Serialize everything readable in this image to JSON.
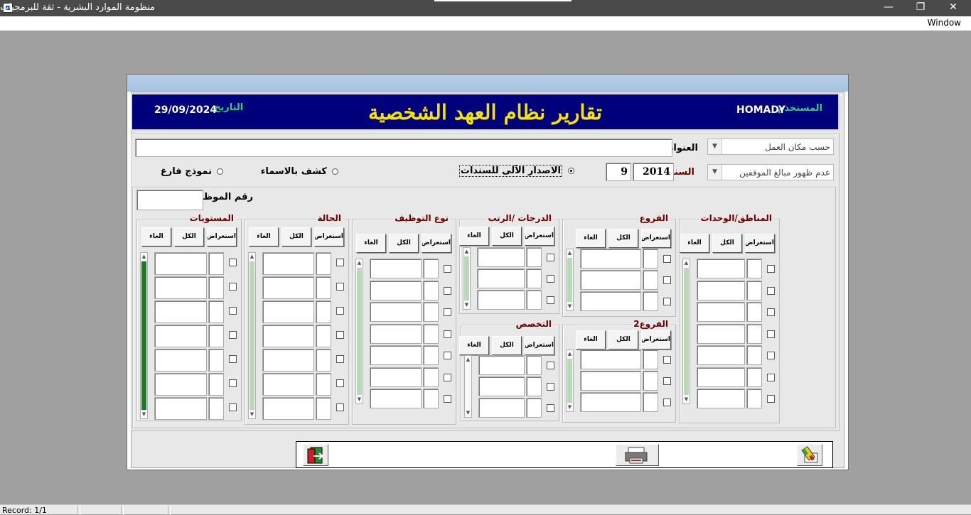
{
  "window": {
    "title": "منظومة الموارد البشرية - ثقة للبرمجيات",
    "minimize": "—",
    "restore": "❐",
    "close": "✕",
    "menu_window": "Window"
  },
  "header": {
    "title": "تقارير نظام العهد الشخصية",
    "user_label": "المستخدم",
    "user_value": "HOMADY",
    "date_label": "التاريخ",
    "date_value": "29/09/2024"
  },
  "filters": {
    "workplace_combo": "حسب مكان العمل",
    "address_label": "العنوان",
    "address_value": "",
    "dues_combo": "عدم ظهور مبالغ الموقفين",
    "year_label": "السنة",
    "year_value": "2014",
    "month_value": "9",
    "radio_auto_issue": "الاصدار الآلى للسندات",
    "radio_names": "كشف بالاسماء",
    "radio_empty": "نموذج فارغ",
    "employee_no_label": "رقم الموظف",
    "employee_no_value": ""
  },
  "panel_buttons": {
    "browse": "استعراض",
    "all": "الكل",
    "cancel": "الغاء"
  },
  "panels": {
    "regions": "المناطق/الوحدات",
    "branches": "الفروع",
    "grades": "الدرجات /الرتب",
    "employment_type": "نوع التوظيف",
    "status": "الحالة",
    "levels": "المستويات",
    "branches2": "الفروع2",
    "specialization": "التخصص"
  },
  "toolbar": {
    "exit_icon": "exit-door-icon",
    "print_icon": "printer-icon",
    "clear_icon": "eraser-icon"
  },
  "status": {
    "record": "Record: 1/1"
  },
  "colors": {
    "header_bg": "#00007a",
    "title_yellow": "#f5e400",
    "label_green": "#33d07a",
    "label_maroon": "#6b0000",
    "scroll_green_dark": "#1e7a1e",
    "scroll_green_light": "#b9d9b9"
  }
}
